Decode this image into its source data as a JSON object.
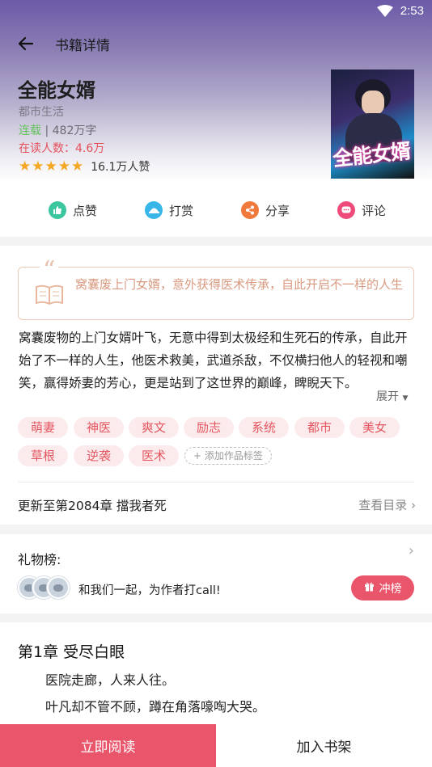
{
  "status_bar": {
    "time": "2:53"
  },
  "header": {
    "title": "书籍详情"
  },
  "book": {
    "title": "全能女婿",
    "genre": "都市生活",
    "status": "连载",
    "word_count": "482万字",
    "readers": "在读人数：4.6万",
    "rating_stars": 5,
    "stars_text": "★★★★★",
    "likes": "16.1万人赞",
    "cover_title": "全能女婿"
  },
  "actions": [
    {
      "label": "点赞",
      "icon": "thumb-up-icon",
      "color": "#3cc6a0"
    },
    {
      "label": "打赏",
      "icon": "reward-icon",
      "color": "#39b6e8"
    },
    {
      "label": "分享",
      "icon": "share-icon",
      "color": "#f07a3c"
    },
    {
      "label": "评论",
      "icon": "comment-icon",
      "color": "#ee4a7a"
    }
  ],
  "intro": {
    "tagline": "窝囊废上门女婿，意外获得医术传承，自此开启不一样的人生",
    "description": "窝囊废物的上门女婿叶飞，无意中得到太极经和生死石的传承，自此开始了不一样的人生，他医术救美，武道杀敌，不仅横扫他人的轻视和嘲笑，赢得娇妻的芳心，更是站到了这世界的巅峰，睥睨天下。",
    "expand_label": "展开"
  },
  "tags": [
    "萌妻",
    "神医",
    "爽文",
    "励志",
    "系统",
    "都市",
    "美女",
    "草根",
    "逆袭",
    "医术"
  ],
  "add_tag_label": "+ 添加作品标签",
  "update": {
    "text": "更新至第2084章 擋我者死",
    "catalog_label": "查看目录"
  },
  "gift": {
    "title": "礼物榜:",
    "cta_text": "和我们一起，为作者打call!",
    "rank_label": "冲榜"
  },
  "chapter": {
    "title": "第1章 受尽白眼",
    "lines": [
      "医院走廊，人来人往。",
      "叶凡却不管不顾，蹲在角落嚎啕大哭。"
    ]
  },
  "bottom": {
    "read_label": "立即阅读",
    "shelf_label": "加入书架"
  },
  "colors": {
    "accent": "#e9556a",
    "tag_bg": "#fcebed",
    "tag_text": "#e3565f",
    "status_green": "#62c25c",
    "star": "#f5a623"
  }
}
